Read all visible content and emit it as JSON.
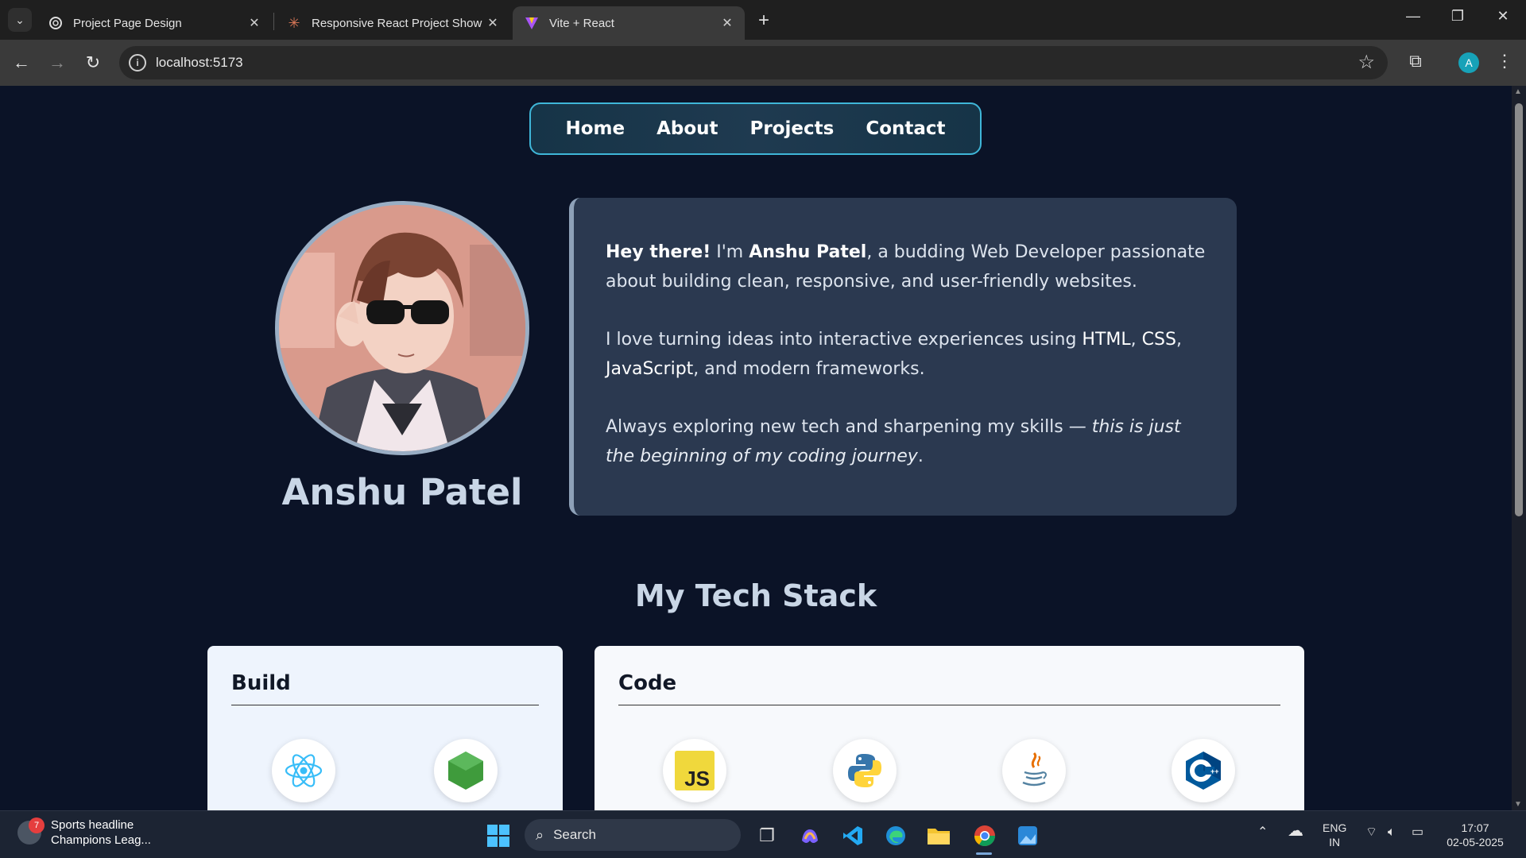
{
  "browser": {
    "tabs": [
      {
        "title": "Project Page Design",
        "active": false
      },
      {
        "title": "Responsive React Project Show",
        "active": false
      },
      {
        "title": "Vite + React",
        "active": true
      }
    ],
    "url": "localhost:5173",
    "profile_initial": "A"
  },
  "nav": {
    "items": [
      "Home",
      "About",
      "Projects",
      "Contact"
    ]
  },
  "profile": {
    "name": "Anshu Patel"
  },
  "bio": {
    "greeting": "Hey there!",
    "im": " I'm ",
    "name": "Anshu Patel",
    "line1_rest": ", a budding Web Developer passionate about building clean, responsive, and user-friendly websites.",
    "p2_start": "I love turning ideas into interactive experiences using ",
    "html": "HTML",
    "css": "CSS",
    "js": "JavaScript",
    "p2_end": ", and modern frameworks.",
    "p3_start": "Always exploring new tech and sharpening my skills — ",
    "p3_italic": "this is just the beginning of my coding journey",
    "p3_end": "."
  },
  "tech_stack": {
    "title": "My Tech Stack",
    "cards": [
      {
        "title": "Build",
        "icons": [
          "react-icon",
          "nodejs-icon"
        ]
      },
      {
        "title": "Code",
        "icons": [
          "javascript-icon",
          "python-icon",
          "java-icon",
          "cpp-icon"
        ]
      }
    ],
    "js_label": "JS"
  },
  "taskbar": {
    "news_badge": "7",
    "news_title": "Sports headline",
    "news_sub": "Champions Leag...",
    "search": "Search",
    "lang1": "ENG",
    "lang2": "IN",
    "time": "17:07",
    "date": "02-05-2025"
  },
  "colors": {
    "page_bg": "#0b1327",
    "nav_border": "#3fb6d8",
    "bio_bg": "#2b3950",
    "card_bg": "#eef4fd"
  }
}
